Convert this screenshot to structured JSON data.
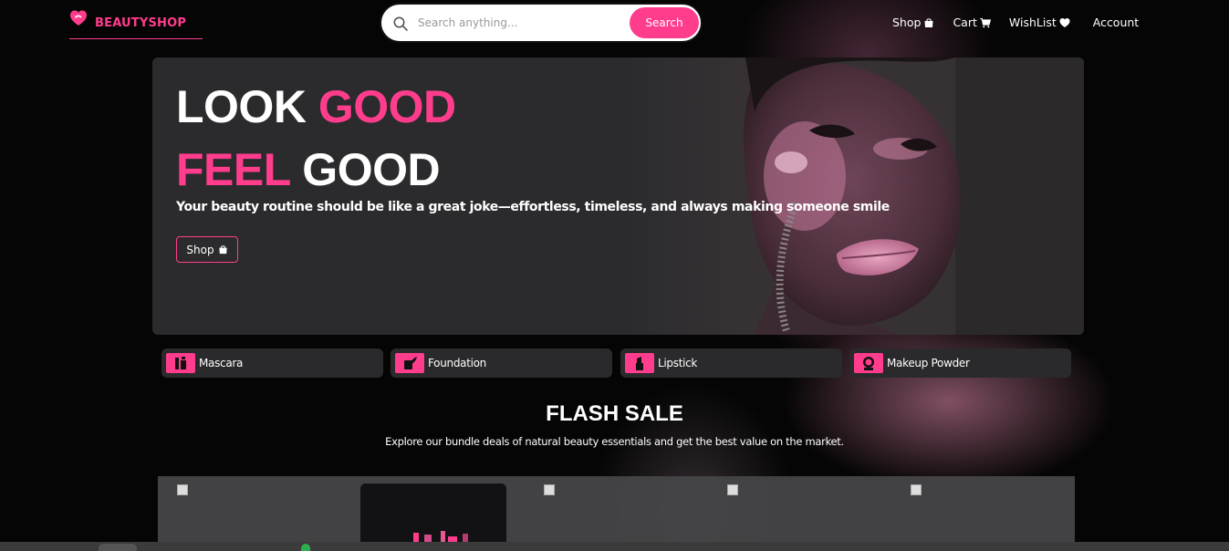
{
  "brand": {
    "name": "BEAUTYSHOP",
    "accent": "#ff3d8c"
  },
  "search": {
    "placeholder": "Search anything...",
    "button_label": "Search"
  },
  "nav": {
    "items": [
      {
        "label": "Shop",
        "icon": "shopping-bag-icon"
      },
      {
        "label": "Cart",
        "icon": "cart-icon"
      },
      {
        "label": "WishList",
        "icon": "heart-icon"
      },
      {
        "label": "Account",
        "icon": ""
      }
    ]
  },
  "hero": {
    "line1_a": "LOOK",
    "line1_b": "GOOD",
    "line2_a": "FEEL",
    "line2_b": "GOOD",
    "subtitle": "Your beauty routine should be like a great joke—effortless, timeless, and always making someone smile",
    "shop_label": "Shop"
  },
  "categories": [
    {
      "label": "Mascara",
      "icon": "mascara-icon"
    },
    {
      "label": "Foundation",
      "icon": "foundation-icon"
    },
    {
      "label": "Lipstick",
      "icon": "lipstick-icon"
    },
    {
      "label": "Makeup Powder",
      "icon": "powder-icon"
    }
  ],
  "flash_sale": {
    "title": "FLASH SALE",
    "subtitle": "Explore our bundle deals of natural beauty essentials and get the best value on the market."
  }
}
